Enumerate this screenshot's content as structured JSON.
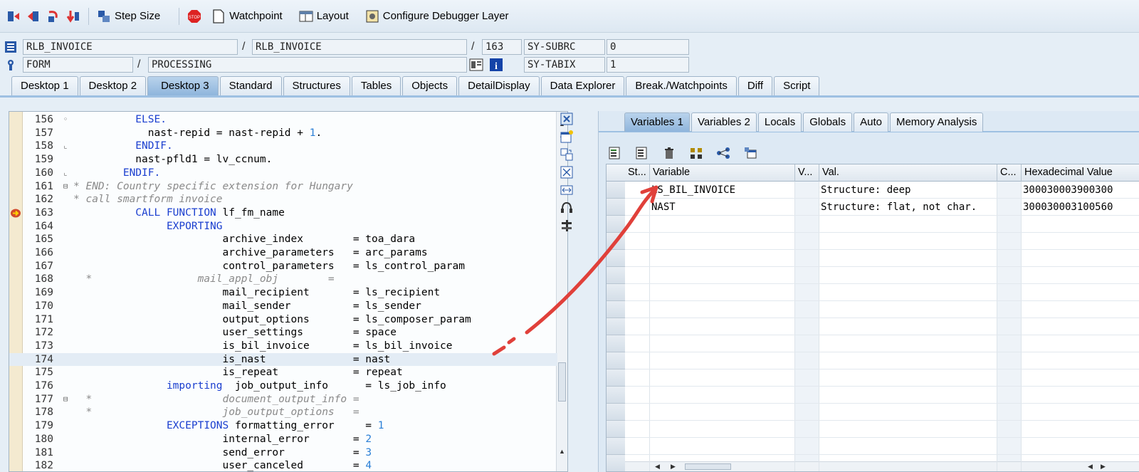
{
  "toolbar": {
    "icons": [
      "single-step-icon",
      "execute-icon",
      "return-icon",
      "continue-icon"
    ],
    "step_size": "Step Size",
    "watchpoint": "Watchpoint",
    "layout": "Layout",
    "configure": "Configure Debugger Layer",
    "stop_label": "STOP"
  },
  "info": {
    "program": "RLB_INVOICE",
    "include": "RLB_INVOICE",
    "line": "163",
    "subrc_label": "SY-SUBRC",
    "subrc_value": "0",
    "event_type": "FORM",
    "event_name": "PROCESSING",
    "tabix_label": "SY-TABIX",
    "tabix_value": "1"
  },
  "tabs": [
    "Desktop 1",
    "Desktop 2",
    "Desktop 3",
    "Standard",
    "Structures",
    "Tables",
    "Objects",
    "DetailDisplay",
    "Data Explorer",
    "Break./Watchpoints",
    "Diff",
    "Script"
  ],
  "active_tab": "Desktop 3",
  "code": [
    {
      "n": "156",
      "fold": "dot",
      "t": [
        {
          "c": "kw",
          "s": "          ELSE."
        }
      ]
    },
    {
      "n": "157",
      "fold": "",
      "t": [
        {
          "c": "",
          "s": "            nast-repid = nast-repid + "
        },
        {
          "c": "num",
          "s": "1"
        },
        {
          "c": "",
          "s": "."
        }
      ]
    },
    {
      "n": "158",
      "fold": "end",
      "t": [
        {
          "c": "kw",
          "s": "          ENDIF."
        }
      ]
    },
    {
      "n": "159",
      "fold": "",
      "t": [
        {
          "c": "",
          "s": "          nast-pfld1 = lv_ccnum."
        }
      ]
    },
    {
      "n": "160",
      "fold": "end",
      "t": [
        {
          "c": "kw",
          "s": "        ENDIF."
        }
      ]
    },
    {
      "n": "161",
      "fold": "box",
      "t": [
        {
          "c": "cm",
          "s": "* END: Country specific extension for Hungary"
        }
      ]
    },
    {
      "n": "162",
      "fold": "",
      "t": [
        {
          "c": "cm",
          "s": "* call smartform invoice"
        }
      ]
    },
    {
      "n": "163",
      "fold": "",
      "t": [
        {
          "c": "kw",
          "s": "          CALL FUNCTION"
        },
        {
          "c": "",
          "s": " lf_fm_name"
        }
      ]
    },
    {
      "n": "164",
      "fold": "",
      "t": [
        {
          "c": "kw",
          "s": "               EXPORTING"
        }
      ]
    },
    {
      "n": "165",
      "fold": "",
      "t": [
        {
          "c": "",
          "s": "                        archive_index        = toa_dara"
        }
      ]
    },
    {
      "n": "166",
      "fold": "",
      "t": [
        {
          "c": "",
          "s": "                        archive_parameters   = arc_params"
        }
      ]
    },
    {
      "n": "167",
      "fold": "",
      "t": [
        {
          "c": "",
          "s": "                        control_parameters   = ls_control_param"
        }
      ]
    },
    {
      "n": "168",
      "fold": "",
      "t": [
        {
          "c": "cm",
          "s": "  *                 mail_appl_obj        ="
        }
      ]
    },
    {
      "n": "169",
      "fold": "",
      "t": [
        {
          "c": "",
          "s": "                        mail_recipient       = ls_recipient"
        }
      ]
    },
    {
      "n": "170",
      "fold": "",
      "t": [
        {
          "c": "",
          "s": "                        mail_sender          = ls_sender"
        }
      ]
    },
    {
      "n": "171",
      "fold": "",
      "t": [
        {
          "c": "",
          "s": "                        output_options       = ls_composer_param"
        }
      ]
    },
    {
      "n": "172",
      "fold": "",
      "t": [
        {
          "c": "",
          "s": "                        user_settings        = space"
        }
      ]
    },
    {
      "n": "173",
      "fold": "",
      "t": [
        {
          "c": "",
          "s": "                        is_bil_invoice       = ls_bil_invoice"
        }
      ]
    },
    {
      "n": "174",
      "fold": "",
      "hl": true,
      "t": [
        {
          "c": "",
          "s": "                        is_nast              = nast"
        }
      ]
    },
    {
      "n": "175",
      "fold": "",
      "t": [
        {
          "c": "",
          "s": "                        is_repeat            = repeat"
        }
      ]
    },
    {
      "n": "176",
      "fold": "",
      "t": [
        {
          "c": "kw",
          "s": "               importing"
        },
        {
          "c": "",
          "s": "  job_output_info      = ls_job_info"
        }
      ]
    },
    {
      "n": "177",
      "fold": "box",
      "t": [
        {
          "c": "cm",
          "s": "  *                     document_output_info ="
        }
      ]
    },
    {
      "n": "178",
      "fold": "",
      "t": [
        {
          "c": "cm",
          "s": "  *                     job_output_options   ="
        }
      ]
    },
    {
      "n": "179",
      "fold": "",
      "t": [
        {
          "c": "kw",
          "s": "               EXCEPTIONS"
        },
        {
          "c": "",
          "s": " formatting_error     = "
        },
        {
          "c": "num",
          "s": "1"
        }
      ]
    },
    {
      "n": "180",
      "fold": "",
      "t": [
        {
          "c": "",
          "s": "                        internal_error       = "
        },
        {
          "c": "num",
          "s": "2"
        }
      ]
    },
    {
      "n": "181",
      "fold": "",
      "t": [
        {
          "c": "",
          "s": "                        send_error           = "
        },
        {
          "c": "num",
          "s": "3"
        }
      ]
    },
    {
      "n": "182",
      "fold": "",
      "t": [
        {
          "c": "",
          "s": "                        user_canceled        = "
        },
        {
          "c": "num",
          "s": "4"
        }
      ]
    }
  ],
  "right": {
    "tabs": [
      "Variables 1",
      "Variables 2",
      "Locals",
      "Globals",
      "Auto",
      "Memory Analysis"
    ],
    "active_tab": "Variables 1",
    "columns": [
      "St...",
      "Variable",
      "V...",
      "Val.",
      "C...",
      "Hexadecimal Value"
    ],
    "rows": [
      {
        "variable": "LS_BIL_INVOICE",
        "value": "Structure: deep",
        "hex": "300030003900300"
      },
      {
        "variable": "NAST",
        "value": "Structure: flat, not char.",
        "hex": "300030003100560"
      }
    ]
  },
  "colors": {
    "keyword": "#1a3ecf",
    "comment": "#8a8a8a",
    "number": "#2a7fd6",
    "annotation_arrow": "#e0403a"
  }
}
